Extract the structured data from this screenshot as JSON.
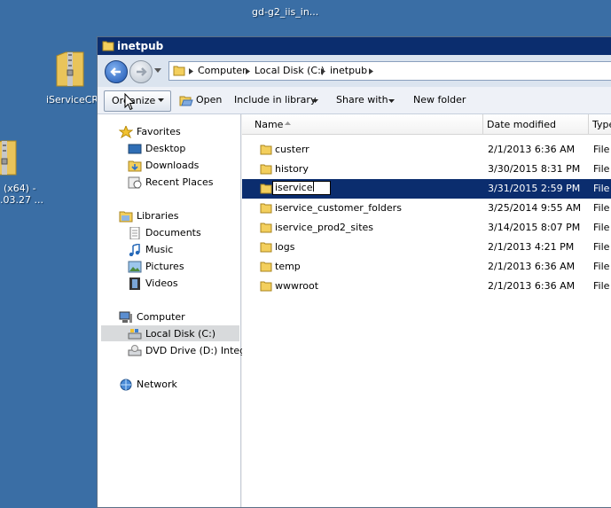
{
  "desktop": {
    "top_label": "gd-g2_iis_in...",
    "icon1_label": "iServiceCRM",
    "icon2_label_line1": "(x64) -",
    "icon2_label_line2": ".03.27 ..."
  },
  "window": {
    "title": "inetpub",
    "breadcrumbs": [
      "Computer",
      "Local Disk (C:)",
      "inetpub"
    ],
    "toolbar": {
      "organize": "Organize",
      "open": "Open",
      "include": "Include in library",
      "share": "Share with",
      "new_folder": "New folder"
    },
    "nav": {
      "favorites": "Favorites",
      "desktop": "Desktop",
      "downloads": "Downloads",
      "recent": "Recent Places",
      "libraries": "Libraries",
      "documents": "Documents",
      "music": "Music",
      "pictures": "Pictures",
      "videos": "Videos",
      "computer": "Computer",
      "local_disk": "Local Disk (C:)",
      "dvd": "DVD Drive (D:) Integra",
      "network": "Network"
    },
    "columns": {
      "name": "Name",
      "date": "Date modified",
      "type": "Type"
    },
    "files": [
      {
        "name": "custerr",
        "date": "2/1/2013 6:36 AM",
        "type": "File"
      },
      {
        "name": "history",
        "date": "3/30/2015 8:31 PM",
        "type": "File"
      },
      {
        "name": "iservice",
        "date": "3/31/2015 2:59 PM",
        "type": "File"
      },
      {
        "name": "iservice_customer_folders",
        "date": "3/25/2014 9:55 AM",
        "type": "File"
      },
      {
        "name": "iservice_prod2_sites",
        "date": "3/14/2015 8:07 PM",
        "type": "File"
      },
      {
        "name": "logs",
        "date": "2/1/2013 4:21 PM",
        "type": "File"
      },
      {
        "name": "temp",
        "date": "2/1/2013 6:36 AM",
        "type": "File"
      },
      {
        "name": "wwwroot",
        "date": "2/1/2013 6:36 AM",
        "type": "File"
      }
    ]
  }
}
